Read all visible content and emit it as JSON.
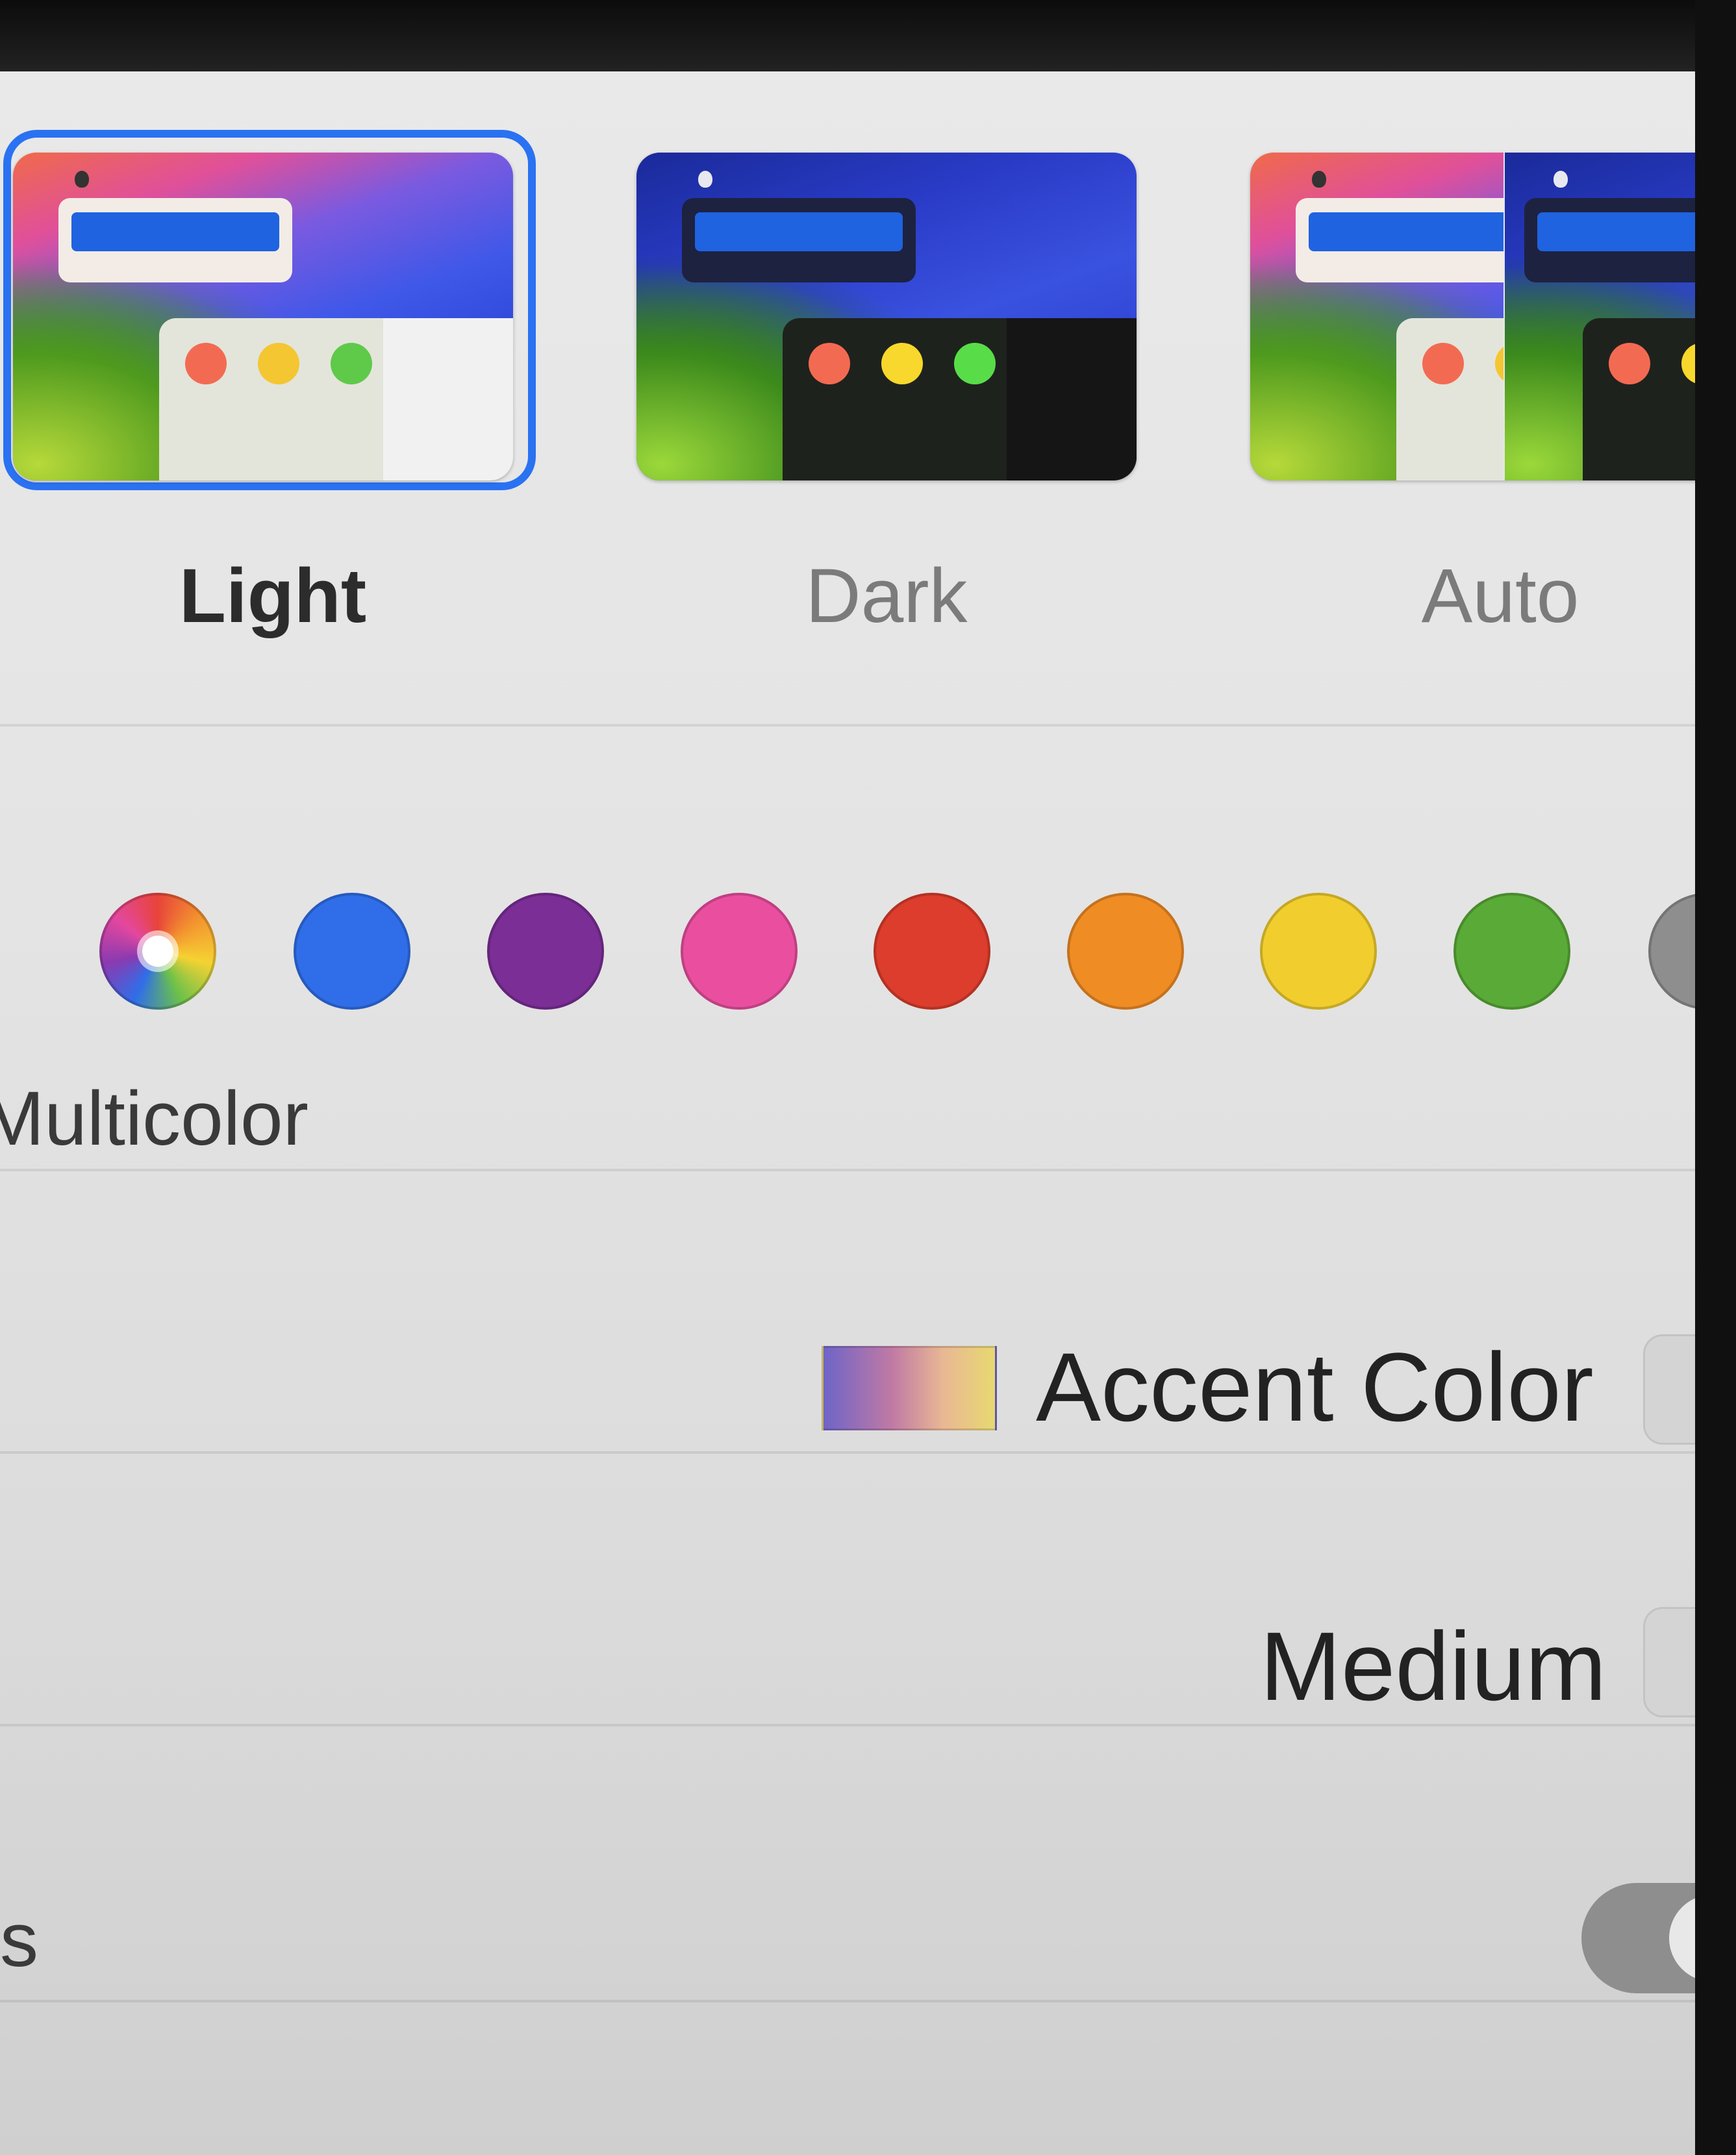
{
  "appearance": {
    "options": [
      {
        "label": "Light",
        "selected": true
      },
      {
        "label": "Dark",
        "selected": false
      },
      {
        "label": "Auto",
        "selected": false
      }
    ]
  },
  "accent": {
    "selected_label": "Multicolor",
    "swatches": [
      {
        "name": "multicolor",
        "color": "multicolor"
      },
      {
        "name": "blue",
        "color": "#2f6ee8"
      },
      {
        "name": "purple",
        "color": "#7b2e96"
      },
      {
        "name": "pink",
        "color": "#ea4f9f"
      },
      {
        "name": "red",
        "color": "#dc3d2c"
      },
      {
        "name": "orange",
        "color": "#f08c24"
      },
      {
        "name": "yellow",
        "color": "#f1ce2e"
      },
      {
        "name": "green",
        "color": "#5aaa38"
      },
      {
        "name": "graphite",
        "color": "#8e8e8e"
      }
    ]
  },
  "highlight": {
    "value": "Accent Color"
  },
  "sidebar_icon_size": {
    "value": "Medium"
  },
  "row3": {
    "label_fragment": "s"
  }
}
